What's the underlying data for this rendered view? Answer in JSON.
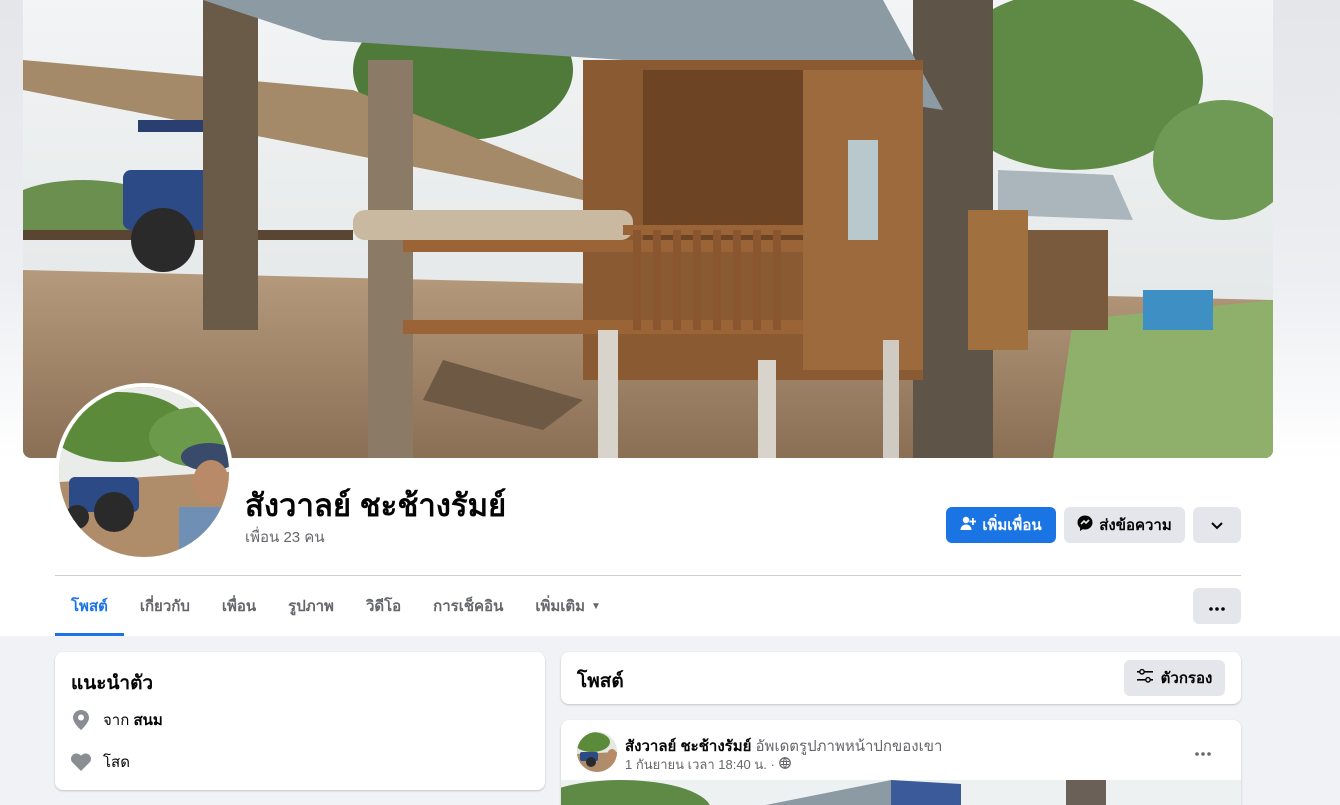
{
  "profile": {
    "name": "สังวาลย์ ชะช้างรัมย์",
    "friends": "เพื่อน 23 คน"
  },
  "actions": {
    "add_friend": "เพิ่มเพื่อน",
    "message": "ส่งข้อความ"
  },
  "tabs": [
    {
      "label": "โพสต์",
      "active": true
    },
    {
      "label": "เกี่ยวกับ",
      "active": false
    },
    {
      "label": "เพื่อน",
      "active": false
    },
    {
      "label": "รูปภาพ",
      "active": false
    },
    {
      "label": "วิดีโอ",
      "active": false
    },
    {
      "label": "การเช็คอิน",
      "active": false
    },
    {
      "label": "เพิ่มเติม",
      "active": false
    }
  ],
  "intro": {
    "title": "แนะนำตัว",
    "from_prefix": "จาก",
    "from_place": "สนม",
    "relationship": "โสด"
  },
  "posts": {
    "title": "โพสต์",
    "filter_label": "ตัวกรอง"
  },
  "post": {
    "author": "สังวาลย์ ชะช้างรัมย์",
    "action": "อัพเดตรูปภาพหน้าปกของเขา",
    "timestamp": "1 กันยายน เวลา 18:40 น. ·"
  },
  "colors": {
    "accent": "#1b74e4",
    "secondary_bg": "#e4e6eb",
    "page_bg": "#f0f2f5",
    "muted_text": "#65676b"
  }
}
